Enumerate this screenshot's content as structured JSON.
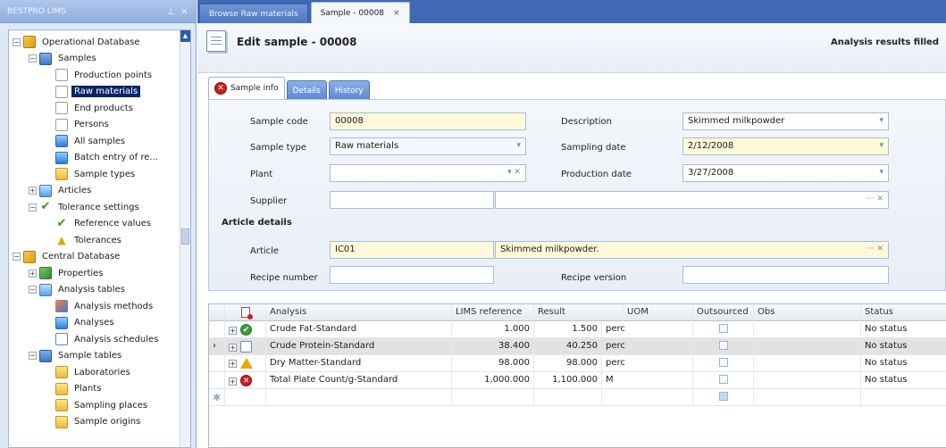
{
  "sidebar": {
    "title": "BESTPRO LIMS",
    "tree": [
      {
        "label": "Operational Database",
        "icon": "database-icon",
        "expanded": true
      },
      {
        "label": "Samples",
        "icon": "samples-icon",
        "expanded": true
      },
      {
        "label": "Production points",
        "icon": "document-icon"
      },
      {
        "label": "Raw materials",
        "icon": "document-icon",
        "selected": true
      },
      {
        "label": "End products",
        "icon": "document-icon"
      },
      {
        "label": "Persons",
        "icon": "document-icon"
      },
      {
        "label": "All samples",
        "icon": "flask-icon"
      },
      {
        "label": "Batch entry of re...",
        "icon": "flask-icon"
      },
      {
        "label": "Sample types",
        "icon": "folder-icon"
      },
      {
        "label": "Articles",
        "icon": "table-icon",
        "expanded": false
      },
      {
        "label": "Tolerance settings",
        "icon": "checkmark-icon",
        "expanded": true
      },
      {
        "label": "Reference values",
        "icon": "checkmark-icon"
      },
      {
        "label": "Tolerances",
        "icon": "warning-icon"
      },
      {
        "label": "Central Database",
        "icon": "database-icon",
        "expanded": true
      },
      {
        "label": "Properties",
        "icon": "properties-icon",
        "expanded": false
      },
      {
        "label": "Analysis tables",
        "icon": "table-icon",
        "expanded": true
      },
      {
        "label": "Analysis methods",
        "icon": "method-icon"
      },
      {
        "label": "Analyses",
        "icon": "flask-icon"
      },
      {
        "label": "Analysis schedules",
        "icon": "schedule-icon"
      },
      {
        "label": "Sample tables",
        "icon": "samples-icon",
        "expanded": true
      },
      {
        "label": "Laboratories",
        "icon": "folder-icon"
      },
      {
        "label": "Plants",
        "icon": "folder-icon"
      },
      {
        "label": "Sampling places",
        "icon": "folder-icon"
      },
      {
        "label": "Sample origins",
        "icon": "folder-icon"
      }
    ]
  },
  "tabs": [
    {
      "label": "Browse Raw materials",
      "active": false
    },
    {
      "label": "Sample - 00008",
      "active": true,
      "close": "×"
    }
  ],
  "header": {
    "title": "Edit sample - 00008",
    "status": "Analysis results filled"
  },
  "inner_tabs": [
    {
      "label": "Sample info",
      "active": true
    },
    {
      "label": "Details",
      "active": false
    },
    {
      "label": "History",
      "active": false
    }
  ],
  "form": {
    "sample_code_label": "Sample code",
    "sample_code": "00008",
    "sample_type_label": "Sample type",
    "sample_type": "Raw materials",
    "plant_label": "Plant",
    "plant": "",
    "supplier_label": "Supplier",
    "supplier": "",
    "description_label": "Description",
    "description": "Skimmed milkpowder",
    "sampling_date_label": "Sampling date",
    "sampling_date": "2/12/2008",
    "production_date_label": "Production date",
    "production_date": "3/27/2008",
    "article_section": "Article details",
    "article_label": "Article",
    "article_code": "IC01",
    "article_name": "Skimmed milkpowder.",
    "recipe_number_label": "Recipe number",
    "recipe_number": "",
    "recipe_version_label": "Recipe version",
    "recipe_version": ""
  },
  "grid": {
    "columns": [
      "Analysis",
      "LIMS reference",
      "Result",
      "UOM",
      "Outsourced",
      "Obs",
      "Status"
    ],
    "rows": [
      {
        "analysis": "Crude Fat-Standard",
        "lims_ref": "1.000",
        "result": "1.500",
        "uom": "perc",
        "outsourced": false,
        "obs": "",
        "status": "No status",
        "icon": "ok"
      },
      {
        "analysis": "Crude Protein-Standard",
        "lims_ref": "38.400",
        "result": "40.250",
        "uom": "perc",
        "outsourced": false,
        "obs": "",
        "status": "No status",
        "icon": "edit",
        "selected": true
      },
      {
        "analysis": "Dry Matter-Standard",
        "lims_ref": "98.000",
        "result": "98.000",
        "uom": "perc",
        "outsourced": false,
        "obs": "",
        "status": "No status",
        "icon": "warn"
      },
      {
        "analysis": "Total Plate Count/g-Standard",
        "lims_ref": "1,000.000",
        "result": "1,100.000",
        "uom": "M",
        "outsourced": false,
        "obs": "",
        "status": "No status",
        "icon": "err"
      }
    ]
  },
  "colors": {
    "tab_bar": "#3f69b3",
    "selection": "#0a246a",
    "error": "#c61f1f",
    "ok": "#3f9b3a",
    "warning": "#e8a800",
    "required_field": "#fdf9da"
  }
}
